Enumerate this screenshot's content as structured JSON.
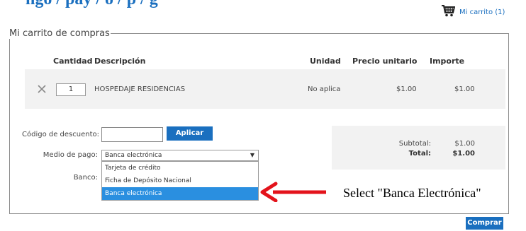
{
  "page": {
    "title_fragment": "ngo / pay / o / p / g"
  },
  "header": {
    "cart_link": "Mi carrito (1)"
  },
  "cart": {
    "legend": "Mi carrito de compras",
    "columns": {
      "quantity": "Cantidad",
      "description": "Descripción",
      "unit": "Unidad",
      "unit_price": "Precio unitario",
      "amount": "Importe"
    },
    "items": [
      {
        "quantity": "1",
        "description": "HOSPEDAJE RESIDENCIAS",
        "unit": "No aplica",
        "unit_price": "$1.00",
        "amount": "$1.00"
      }
    ]
  },
  "discount": {
    "label": "Código de descuento:",
    "value": "",
    "apply_button": "Aplicar"
  },
  "payment": {
    "label": "Medio de pago:",
    "selected": "Banca electrónica",
    "options": [
      "Tarjeta de crédito",
      "Ficha de Depósito Nacional",
      "Banca electrónica"
    ],
    "bank_label": "Banco:"
  },
  "totals": {
    "subtotal_label": "Subtotal:",
    "subtotal_value": "$1.00",
    "total_label": "Total:",
    "total_value": "$1.00"
  },
  "annotation": {
    "text": "Select \"Banca Electrónica\""
  },
  "actions": {
    "buy_button": "Comprar"
  },
  "colors": {
    "accent": "#1a6fbf",
    "highlight": "#2a8fe0",
    "arrow": "#e3131b",
    "row_bg": "#f2f2f2"
  }
}
